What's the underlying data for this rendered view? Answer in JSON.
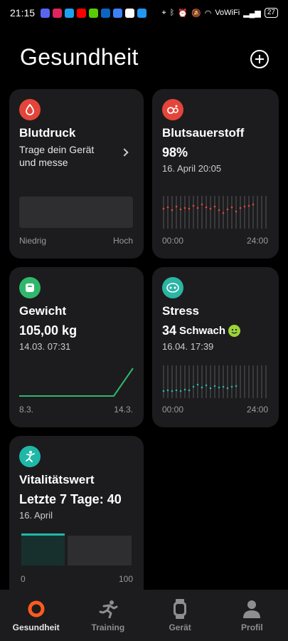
{
  "status_bar": {
    "time": "21:15",
    "network": "VoWiFi",
    "battery": "27"
  },
  "header": {
    "title": "Gesundheit"
  },
  "cards": {
    "blood_pressure": {
      "title": "Blutdruck",
      "description": "Trage dein Gerät und messe",
      "axis_low": "Niedrig",
      "axis_high": "Hoch",
      "icon_color": "#e4453a"
    },
    "blood_oxygen": {
      "title": "Blutsauerstoff",
      "value": "98%",
      "date": "16. April 20:05",
      "axis_start": "00:00",
      "axis_end": "24:00",
      "icon_color": "#e4453a",
      "accent": "#e4453a"
    },
    "weight": {
      "title": "Gewicht",
      "value": "105,00 kg",
      "date": "14.03. 07:31",
      "axis_start": "8.3.",
      "axis_end": "14.3.",
      "icon_color": "#2fb86c",
      "accent": "#2fb86c"
    },
    "stress": {
      "title": "Stress",
      "value": "34",
      "level": "Schwach",
      "date": "16.04. 17:39",
      "axis_start": "00:00",
      "axis_end": "24:00",
      "icon_color": "#2bb5a3",
      "accent": "#2bb5a3",
      "badge_color": "#9bd33a"
    },
    "vitality": {
      "title": "Vitalitätswert",
      "value": "Letzte 7 Tage: 40",
      "date": "16. April",
      "axis_start": "0",
      "axis_end": "100",
      "icon_color": "#1fb8a8",
      "accent": "#1fb8a8"
    }
  },
  "nav": {
    "items": [
      {
        "label": "Gesundheit",
        "icon": "health-ring-icon",
        "active": true
      },
      {
        "label": "Training",
        "icon": "running-icon",
        "active": false
      },
      {
        "label": "Gerät",
        "icon": "watch-icon",
        "active": false
      },
      {
        "label": "Profil",
        "icon": "person-icon",
        "active": false
      }
    ]
  }
}
